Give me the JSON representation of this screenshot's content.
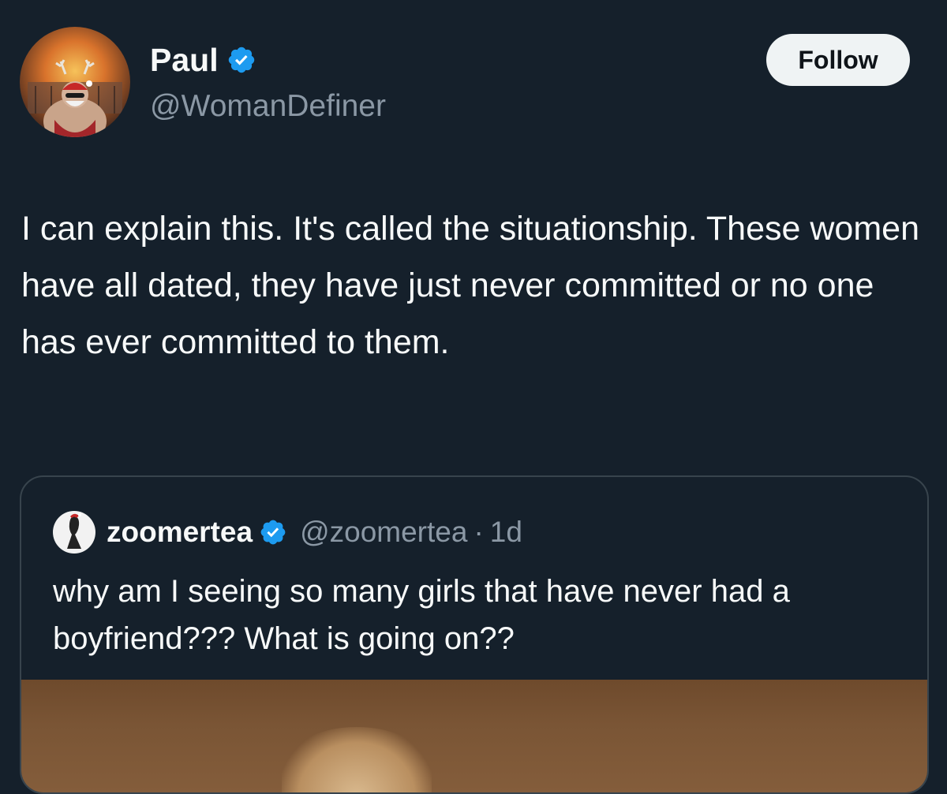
{
  "author": {
    "display_name": "Paul",
    "handle": "@WomanDefiner",
    "verified": true,
    "avatar_icon": "avatar-image"
  },
  "follow_button": {
    "label": "Follow"
  },
  "tweet": {
    "text": "I can explain this. It's called the situationship. These women have all dated, they have just never committed or no one has ever committed to them."
  },
  "quote": {
    "display_name": "zoomertea",
    "handle": "@zoomertea",
    "separator": "·",
    "time": "1d",
    "verified": true,
    "text": "why am I seeing so many girls that have never had a boyfriend??? What is going on??"
  },
  "colors": {
    "background": "#15202b",
    "text_primary": "#f7f9f9",
    "text_secondary": "#8b98a5",
    "verified_blue": "#1d9bf0",
    "follow_button_bg": "#eff3f4",
    "border": "#38444d"
  }
}
